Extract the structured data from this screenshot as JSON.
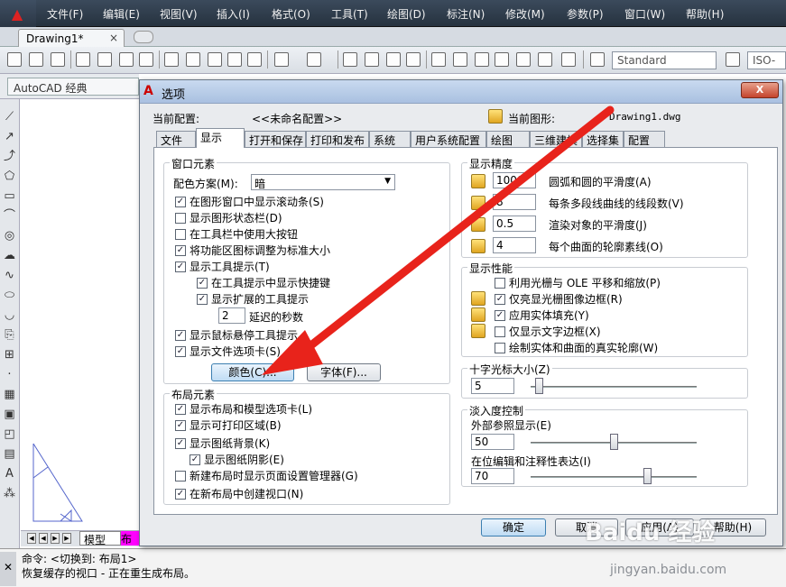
{
  "menubar": {
    "items": [
      "文件(F)",
      "编辑(E)",
      "视图(V)",
      "插入(I)",
      "格式(O)",
      "工具(T)",
      "绘图(D)",
      "标注(N)",
      "修改(M)",
      "参数(P)",
      "窗口(W)",
      "帮助(H)"
    ]
  },
  "doc_tab": {
    "label": "Drawing1*",
    "close": "×"
  },
  "toolbar": {
    "text_style": "Standard",
    "dim_style": "ISO-"
  },
  "workspace": {
    "label": "AutoCAD 经典"
  },
  "model_tabs": {
    "model": "模型",
    "layout": "布"
  },
  "command": {
    "line1": "命令:   <切换到: 布局1>",
    "line2": "恢复缓存的视口 - 正在重生成布局。"
  },
  "dialog": {
    "title": "选项",
    "close": "X",
    "current_profile_label": "当前配置:",
    "current_profile_value": "<<未命名配置>>",
    "current_drawing_label": "当前图形:",
    "current_drawing_value": "Drawing1.dwg",
    "tabs": [
      "文件",
      "显示",
      "打开和保存",
      "打印和发布",
      "系统",
      "用户系统配置",
      "绘图",
      "三维建模",
      "选择集",
      "配置"
    ],
    "active_tab": "显示",
    "window_elements": {
      "title": "窗口元素",
      "color_scheme_label": "配色方案(M):",
      "color_scheme_value": "暗",
      "options": [
        {
          "label": "在图形窗口中显示滚动条(S)",
          "checked": true
        },
        {
          "label": "显示图形状态栏(D)",
          "checked": false
        },
        {
          "label": "在工具栏中使用大按钮",
          "checked": false
        },
        {
          "label": "将功能区图标调整为标准大小",
          "checked": true
        },
        {
          "label": "显示工具提示(T)",
          "checked": true
        },
        {
          "label": "在工具提示中显示快捷键",
          "checked": true
        },
        {
          "label": "显示扩展的工具提示",
          "checked": true
        },
        {
          "label": "显示鼠标悬停工具提示",
          "checked": true
        },
        {
          "label": "显示文件选项卡(S)",
          "checked": true
        }
      ],
      "delay_value": "2",
      "delay_label": "延迟的秒数",
      "colors_button": "颜色(C)...",
      "fonts_button": "字体(F)..."
    },
    "layout_elements": {
      "title": "布局元素",
      "options": [
        {
          "label": "显示布局和模型选项卡(L)",
          "checked": true
        },
        {
          "label": "显示可打印区域(B)",
          "checked": true
        },
        {
          "label": "显示图纸背景(K)",
          "checked": true
        },
        {
          "label": "显示图纸阴影(E)",
          "checked": true
        },
        {
          "label": "新建布局时显示页面设置管理器(G)",
          "checked": false
        },
        {
          "label": "在新布局中创建视口(N)",
          "checked": true
        }
      ]
    },
    "display_resolution": {
      "title": "显示精度",
      "rows": [
        {
          "value": "1000",
          "label": "圆弧和圆的平滑度(A)"
        },
        {
          "value": "8",
          "label": "每条多段线曲线的线段数(V)"
        },
        {
          "value": "0.5",
          "label": "渲染对象的平滑度(J)"
        },
        {
          "value": "4",
          "label": "每个曲面的轮廓素线(O)"
        }
      ]
    },
    "display_performance": {
      "title": "显示性能",
      "options": [
        {
          "label": "利用光栅与 OLE 平移和缩放(P)",
          "checked": false
        },
        {
          "label": "仅亮显光栅图像边框(R)",
          "checked": true
        },
        {
          "label": "应用实体填充(Y)",
          "checked": true
        },
        {
          "label": "仅显示文字边框(X)",
          "checked": false
        },
        {
          "label": "绘制实体和曲面的真实轮廓(W)",
          "checked": false
        }
      ]
    },
    "crosshair": {
      "title": "十字光标大小(Z)",
      "value": "5",
      "level_fraction": 0.05
    },
    "fade": {
      "title": "淡入度控制",
      "xref_label": "外部参照显示(E)",
      "xref_value": "50",
      "xref_fraction": 0.5,
      "inplace_label": "在位编辑和注释性表达(I)",
      "inplace_value": "70",
      "inplace_fraction": 0.7
    },
    "buttons": {
      "ok": "确定",
      "cancel": "取消",
      "apply": "应用(A)",
      "help": "帮助(H)"
    }
  },
  "watermark": {
    "brand": "Baidu 经验",
    "url": "jingyan.baidu.com"
  },
  "colors": {
    "arrow": "#e8231b",
    "menubar": "#2e3a48",
    "layout_tab": "#ff00ff"
  }
}
